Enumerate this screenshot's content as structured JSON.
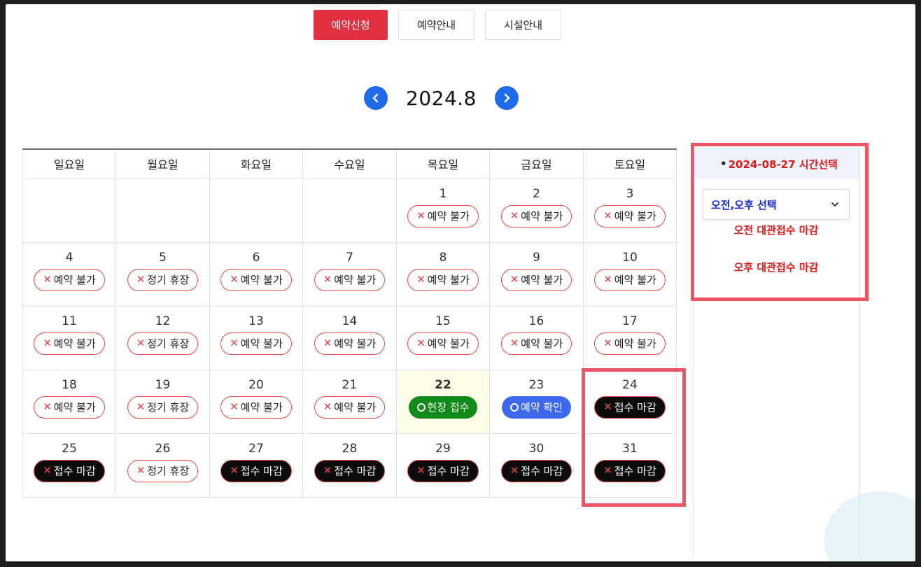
{
  "tabs": [
    {
      "label": "예약신청",
      "active": true
    },
    {
      "label": "예약안내",
      "active": false
    },
    {
      "label": "시설안내",
      "active": false
    }
  ],
  "month_nav": {
    "title": "2024.8",
    "prev_icon": "chevron-left-icon",
    "next_icon": "chevron-right-icon"
  },
  "calendar": {
    "weekdays": [
      "일요일",
      "월요일",
      "화요일",
      "수요일",
      "목요일",
      "금요일",
      "토요일"
    ],
    "weeks": [
      [
        null,
        null,
        null,
        null,
        {
          "day": "1",
          "status": "unavail",
          "label": "예약 불가"
        },
        {
          "day": "2",
          "status": "unavail",
          "label": "예약 불가"
        },
        {
          "day": "3",
          "status": "unavail",
          "label": "예약 불가"
        }
      ],
      [
        {
          "day": "4",
          "status": "unavail",
          "label": "예약 불가"
        },
        {
          "day": "5",
          "status": "closed-day",
          "label": "정기 휴장"
        },
        {
          "day": "6",
          "status": "unavail",
          "label": "예약 불가"
        },
        {
          "day": "7",
          "status": "unavail",
          "label": "예약 불가"
        },
        {
          "day": "8",
          "status": "unavail",
          "label": "예약 불가"
        },
        {
          "day": "9",
          "status": "unavail",
          "label": "예약 불가"
        },
        {
          "day": "10",
          "status": "unavail",
          "label": "예약 불가"
        }
      ],
      [
        {
          "day": "11",
          "status": "unavail",
          "label": "예약 불가"
        },
        {
          "day": "12",
          "status": "closed-day",
          "label": "정기 휴장"
        },
        {
          "day": "13",
          "status": "unavail",
          "label": "예약 불가"
        },
        {
          "day": "14",
          "status": "unavail",
          "label": "예약 불가"
        },
        {
          "day": "15",
          "status": "unavail",
          "label": "예약 불가"
        },
        {
          "day": "16",
          "status": "unavail",
          "label": "예약 불가"
        },
        {
          "day": "17",
          "status": "unavail",
          "label": "예약 불가"
        }
      ],
      [
        {
          "day": "18",
          "status": "unavail",
          "label": "예약 불가"
        },
        {
          "day": "19",
          "status": "closed-day",
          "label": "정기 휴장"
        },
        {
          "day": "20",
          "status": "unavail",
          "label": "예약 불가"
        },
        {
          "day": "21",
          "status": "unavail",
          "label": "예약 불가"
        },
        {
          "day": "22",
          "status": "onsite",
          "label": "현장 접수",
          "today": true
        },
        {
          "day": "23",
          "status": "confirm",
          "label": "예약 확인"
        },
        {
          "day": "24",
          "status": "closed",
          "label": "접수 마감"
        }
      ],
      [
        {
          "day": "25",
          "status": "closed",
          "label": "접수 마감"
        },
        {
          "day": "26",
          "status": "closed-day",
          "label": "정기 휴장"
        },
        {
          "day": "27",
          "status": "closed",
          "label": "접수 마감"
        },
        {
          "day": "28",
          "status": "closed",
          "label": "접수 마감"
        },
        {
          "day": "29",
          "status": "closed",
          "label": "접수 마감"
        },
        {
          "day": "30",
          "status": "closed",
          "label": "접수 마감"
        },
        {
          "day": "31",
          "status": "closed",
          "label": "접수 마감"
        }
      ]
    ]
  },
  "side_panel": {
    "header_bullet": "•",
    "header": "2024-08-27 시간선택",
    "select_value": "오전,오후 선택",
    "am_message": "오전 대관접수 마감",
    "pm_message": "오후 대관접수 마감"
  },
  "colors": {
    "accent": "#e0303f",
    "nav_blue": "#1e6ae8",
    "highlight": "#ee5564",
    "onsite": "#128a1a",
    "confirm": "#3d67ee"
  }
}
